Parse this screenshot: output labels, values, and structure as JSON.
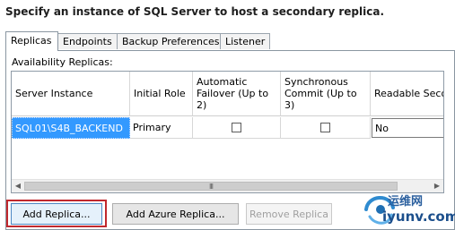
{
  "header": {
    "title": "Specify an instance of SQL Server to host a secondary replica."
  },
  "tabs": [
    {
      "label": "Replicas"
    },
    {
      "label": "Endpoints"
    },
    {
      "label": "Backup Preferences"
    },
    {
      "label": "Listener"
    }
  ],
  "replicas": {
    "group_label": "Availability Replicas:",
    "columns": [
      "Server Instance",
      "Initial Role",
      "Automatic Failover (Up to 2)",
      "Synchronous Commit (Up to 3)",
      "Readable Secon"
    ],
    "rows": [
      {
        "server_instance": "SQL01\\S4B_BACKEND",
        "initial_role": "Primary",
        "automatic_failover": false,
        "synchronous_commit": false,
        "readable_secondary": "No"
      }
    ],
    "scroll_grip": "III"
  },
  "buttons": {
    "add_replica": "Add Replica...",
    "add_azure_replica": "Add Azure Replica...",
    "remove_replica": "Remove Replica"
  },
  "watermark": {
    "top": "运维网",
    "bottom": "iyunv.com"
  }
}
